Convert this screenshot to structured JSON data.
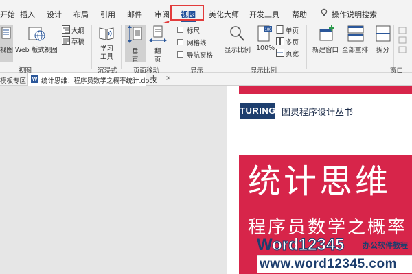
{
  "menu": {
    "tabs": [
      "开始",
      "插入",
      "设计",
      "布局",
      "引用",
      "邮件",
      "审阅",
      "视图",
      "美化大师",
      "开发工具",
      "帮助"
    ],
    "active_tab": "视图",
    "search_placeholder": "操作说明搜索"
  },
  "ribbon": {
    "views": {
      "read_mode": "视图",
      "web_layout": "Web 版式视图",
      "outline": "大纲",
      "draft": "草稿",
      "group_label": "视图"
    },
    "immersive": {
      "learning_tools_line1": "学习",
      "learning_tools_line2": "工具",
      "group_label": "沉浸式"
    },
    "page_movement": {
      "vertical_line1": "垂",
      "vertical_line2": "直",
      "side_to_side_line1": "翻",
      "side_to_side_line2": "页",
      "group_label": "页面移动"
    },
    "show": {
      "ruler": "标尺",
      "gridlines": "网格线",
      "nav_pane": "导航窗格",
      "group_label": "显示"
    },
    "zoom": {
      "zoom": "显示比例",
      "hundred": "100%",
      "one_page": "单页",
      "multi_page": "多页",
      "page_width": "页宽",
      "group_label": "显示比例"
    },
    "window": {
      "new_window": "新建窗口",
      "arrange_all": "全部重排",
      "split": "拆分",
      "group_label": "窗口"
    }
  },
  "doc_tabs": {
    "template_zone": "模板专区",
    "file_name": "统计思维：程序员数学之概率统计.docx",
    "close": "×",
    "add": "+"
  },
  "document": {
    "publisher_logo": "TURING",
    "series": "图灵程序设计丛书",
    "title": "统计思维",
    "subtitle": "程序员数学之概率"
  },
  "watermark": {
    "brand_w": "W",
    "brand_num": "ord12345",
    "tagline": "办公软件教程",
    "url": "www.word12345.com"
  },
  "colors": {
    "accent_red": "#d7254a",
    "ribbon_bg": "#f3f3f3",
    "word_blue": "#2b579a",
    "highlight_red": "#e23b3b"
  }
}
